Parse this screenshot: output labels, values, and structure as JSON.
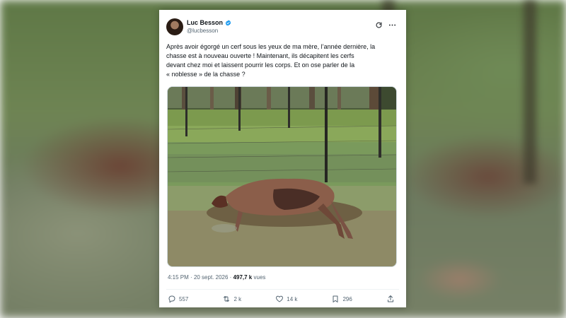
{
  "tweet": {
    "author_name": "Luc Besson",
    "author_handle": "@lucbesson",
    "text_lines": [
      "Après avoir égorgé un cerf sous les yeux de ma mère, l’année dernière, la",
      "chasse est à nouveau ouverte ! Maintenant, ils décapitent les cerfs",
      "devant chez moi et laissent pourrir les corps. Et on ose parler de la",
      "« noblesse » de la chasse ?"
    ],
    "time": "4:15 PM",
    "date": "20 sept. 2026",
    "separator": "·",
    "views_count": "497,7 k",
    "views_label": "vues",
    "replies": "557",
    "reposts": "2 k",
    "likes": "14 k",
    "bookmarks": "296"
  },
  "icons": {
    "verified": "verified-badge-icon",
    "grok": "grok-icon",
    "more": "more-icon",
    "reply": "reply-icon",
    "repost": "repost-icon",
    "like": "heart-icon",
    "bookmark": "bookmark-icon",
    "share": "share-icon"
  },
  "colors": {
    "verified_blue": "#1d9bf0",
    "text_primary": "#0f1419",
    "text_secondary": "#536471"
  }
}
